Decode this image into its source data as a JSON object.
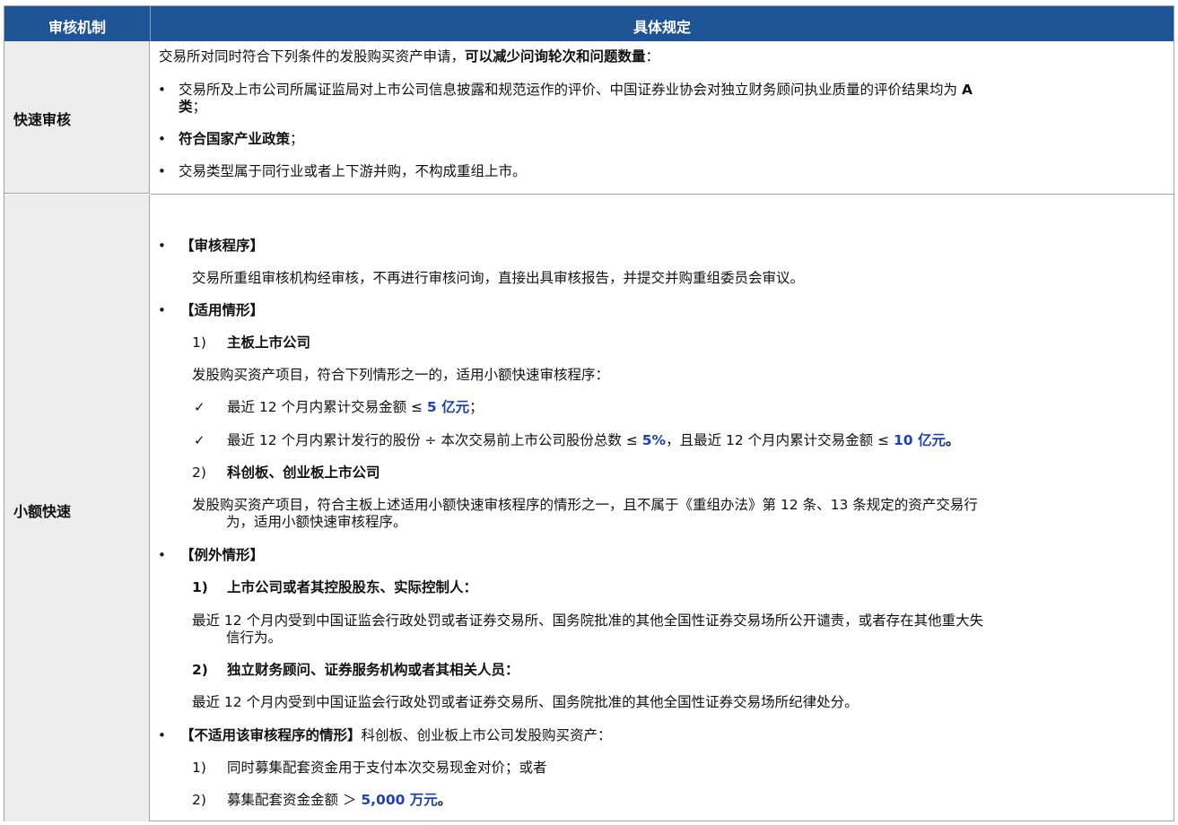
{
  "header": {
    "col1": "审核机制",
    "col2": "具体规定"
  },
  "fast_review": {
    "label": "快速审核",
    "intro_a": "交易所对同时符合下列条件的发股购买资产申请，",
    "intro_b": "可以减少问询轮次和问题数量",
    "intro_c": "：",
    "bullet1_a": "交易所及上市公司所属证监局对上市公司信息披露和规范运作的评价、中国证券业协会对独立财务顾问执业质量的评价结果均为 ",
    "bullet1_b": "A",
    "bullet1_c": "类",
    "bullet1_d": "；",
    "bullet2_a": "符合国家产业政策",
    "bullet2_b": "；",
    "bullet3": "交易类型属于同行业或者上下游并购，不构成重组上市。"
  },
  "small_fast": {
    "label": "小额快速",
    "s1_title": "【审核程序】",
    "s1_text": "交易所重组审核机构经审核，不再进行审核问询，直接出具审核报告，并提交并购重组委员会审议。",
    "s2_title": "【适用情形】",
    "s2_i1_num": "1)",
    "s2_i1_title": "主板上市公司",
    "s2_i1_text": "发股购买资产项目，符合下列情形之一的，适用小额快速审核程序：",
    "check1_a": "最近 12 个月内累计交易金额 ≤ ",
    "check1_b": "5 亿元",
    "check1_c": "；",
    "check2_a": "最近 12 个月内累计发行的股份 ÷ 本次交易前上市公司股份总数 ≤ ",
    "check2_b": "5%",
    "check2_c": "，且最近 12 个月内累计交易金额 ≤ ",
    "check2_d": "10 亿元",
    "check2_e": "。",
    "s2_i2_num": "2)",
    "s2_i2_title": "科创板、创业板上市公司",
    "s2_i2_text_1": "发股购买资产项目，符合主板上述适用小额快速审核程序的情形之一，且不属于《重组办法》第 12 条、13 条规定的资产交易行",
    "s2_i2_text_2": "为，适用小额快速审核程序。",
    "s3_title": "【例外情形】",
    "s3_i1_num": "1)",
    "s3_i1_title": "上市公司或者其控股股东、实际控制人：",
    "s3_i1_text_1": "最近 12 个月内受到中国证监会行政处罚或者证券交易所、国务院批准的其他全国性证券交易场所公开谴责，或者存在其他重大失",
    "s3_i1_text_2": "信行为。",
    "s3_i2_num": "2)",
    "s3_i2_title": "独立财务顾问、证券服务机构或者其相关人员：",
    "s3_i2_text": "最近 12 个月内受到中国证监会行政处罚或者证券交易所、国务院批准的其他全国性证券交易场所纪律处分。",
    "s4_title": "【不适用该审核程序的情形】",
    "s4_text": "科创板、创业板上市公司发股购买资产：",
    "s4_i1_num": "1)",
    "s4_i1_text": "同时募集配套资金用于支付本次交易现金对价；或者",
    "s4_i2_num": "2)",
    "s4_i2_a": "募集配套资金金额 ＞ ",
    "s4_i2_b": "5,000 万元",
    "s4_i2_c": "。"
  },
  "glyphs": {
    "bullet": "•",
    "check": "✓"
  }
}
